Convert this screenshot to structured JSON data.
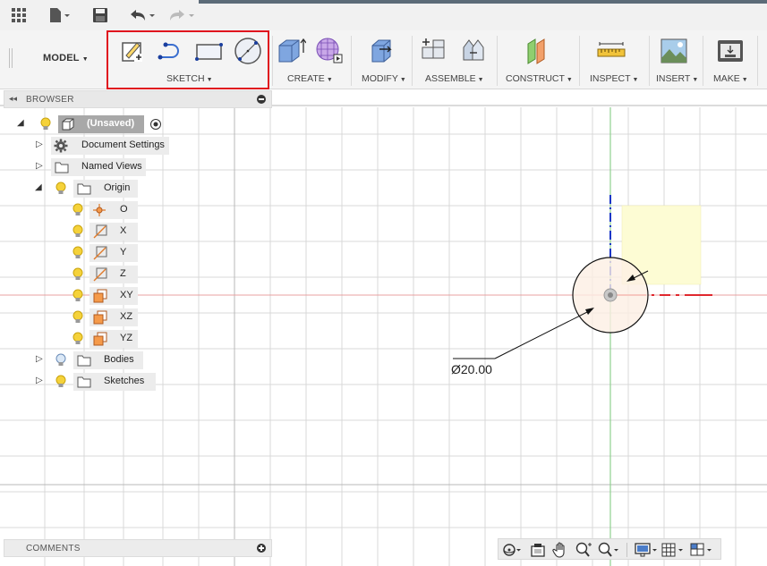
{
  "workspace": {
    "label": "MODEL"
  },
  "ribbon": {
    "groups": [
      {
        "id": "sketch",
        "label": "SKETCH"
      },
      {
        "id": "create",
        "label": "CREATE"
      },
      {
        "id": "modify",
        "label": "MODIFY"
      },
      {
        "id": "assemble",
        "label": "ASSEMBLE"
      },
      {
        "id": "construct",
        "label": "CONSTRUCT"
      },
      {
        "id": "inspect",
        "label": "INSPECT"
      },
      {
        "id": "insert",
        "label": "INSERT"
      },
      {
        "id": "make",
        "label": "MAKE"
      }
    ],
    "highlight_color": "#e0141e"
  },
  "browser": {
    "title": "BROWSER",
    "root": {
      "label": "(Unsaved)"
    },
    "items": [
      {
        "label": "Document Settings",
        "icon": "gear-icon"
      },
      {
        "label": "Named Views",
        "icon": "folder-icon"
      },
      {
        "label": "Origin",
        "icon": "folder-icon"
      },
      {
        "label": "O",
        "icon": "origin-point-icon"
      },
      {
        "label": "X",
        "icon": "axis-icon"
      },
      {
        "label": "Y",
        "icon": "axis-icon"
      },
      {
        "label": "Z",
        "icon": "axis-icon"
      },
      {
        "label": "XY",
        "icon": "plane-icon"
      },
      {
        "label": "XZ",
        "icon": "plane-icon"
      },
      {
        "label": "YZ",
        "icon": "plane-icon"
      },
      {
        "label": "Bodies",
        "icon": "folder-icon"
      },
      {
        "label": "Sketches",
        "icon": "folder-icon"
      }
    ]
  },
  "comments": {
    "title": "COMMENTS"
  },
  "sketch": {
    "dimension": "Ø20.00"
  },
  "colors": {
    "x_axis": "#e0282e",
    "y_axis": "#44b044",
    "z_axis": "#1a36c8",
    "bulb": "#f5d23a",
    "plane": "#e88a3c"
  }
}
